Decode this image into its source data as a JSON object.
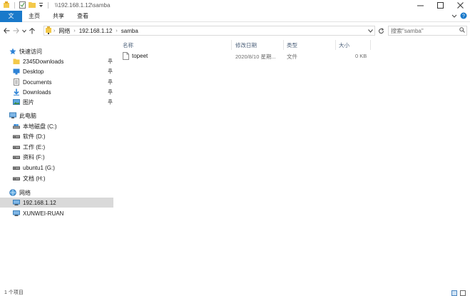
{
  "titlebar": {
    "path": "\\\\192.168.1.12\\samba",
    "controls": {
      "minimize": "—",
      "maximize": "☐",
      "close": "✕"
    }
  },
  "ribbon": {
    "tabs": [
      "文件",
      "主页",
      "共享",
      "查看"
    ],
    "collapse_glyph": "⌄",
    "help_glyph": "?"
  },
  "address": {
    "crumbs": [
      "网络",
      "192.168.1.12",
      "samba"
    ],
    "separator": "›"
  },
  "search": {
    "placeholder": "搜索\"samba\""
  },
  "nav": {
    "quick_access": {
      "label": "快速访问",
      "items": [
        "2345Downloads",
        "Desktop",
        "Documents",
        "Downloads",
        "图片"
      ]
    },
    "this_pc": {
      "label": "此电脑",
      "drives": [
        "本地磁盘 (C:)",
        "软件 (D:)",
        "工作 (E:)",
        "资料 (F:)",
        "ubuntu1 (G:)",
        "文档 (H:)"
      ]
    },
    "network": {
      "label": "网络",
      "items": [
        "192.168.1.12",
        "XUNWEI-RUAN"
      ]
    }
  },
  "filelist": {
    "columns": [
      "名称",
      "修改日期",
      "类型",
      "大小"
    ],
    "rows": [
      {
        "name": "topeet",
        "modified": "2020/8/10 星期...",
        "type": "文件",
        "size": "0 KB"
      }
    ]
  },
  "status": {
    "text": "1 个项目"
  },
  "colors": {
    "accent": "#1979ca",
    "selected": "#d9d9d9",
    "folder": "#f3c94b",
    "header_text": "#4c607a"
  }
}
